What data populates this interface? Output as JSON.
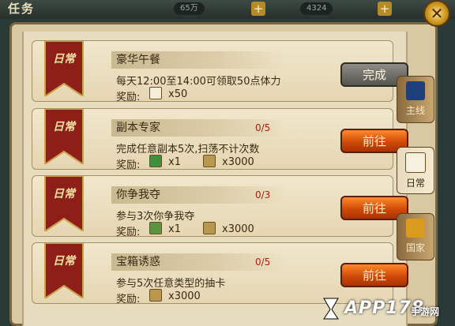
{
  "header": {
    "title": "任务",
    "stats": [
      "65万",
      "4324"
    ]
  },
  "tabs": [
    {
      "label": "主线"
    },
    {
      "label": "日常"
    },
    {
      "label": "国家"
    }
  ],
  "reward_label": "奖励:",
  "tasks": [
    {
      "tag": "日常",
      "name": "豪华午餐",
      "progress": "",
      "desc": "每天12:00至14:00可领取50点体力",
      "rewards": [
        {
          "icon": "food-icon",
          "value": "x50"
        }
      ],
      "button": "完成"
    },
    {
      "tag": "日常",
      "name": "副本专家",
      "progress": "0/5",
      "desc": "完成任意副本5次,扫荡不计次数",
      "rewards": [
        {
          "icon": "gem-icon",
          "value": "x1"
        },
        {
          "icon": "coin-icon",
          "value": "x3000"
        }
      ],
      "button": "前往"
    },
    {
      "tag": "日常",
      "name": "你争我夺",
      "progress": "0/3",
      "desc": "参与3次你争我夺",
      "rewards": [
        {
          "icon": "fruit-icon",
          "value": "x1"
        },
        {
          "icon": "coin-icon",
          "value": "x3000"
        }
      ],
      "button": "前往"
    },
    {
      "tag": "日常",
      "name": "宝箱诱惑",
      "progress": "0/5",
      "desc": "参与5次任意类型的抽卡",
      "rewards": [
        {
          "icon": "coin-icon",
          "value": "x3000"
        }
      ],
      "button": "前往"
    }
  ],
  "watermark": {
    "main": "APP178",
    "sub": "手游网",
    "url": "www.app178.com"
  },
  "colors": {
    "accent_button": "#d04a08",
    "done_button": "#6e6d67",
    "progress": "#b01e12",
    "ribbon": "#8e1e18"
  }
}
